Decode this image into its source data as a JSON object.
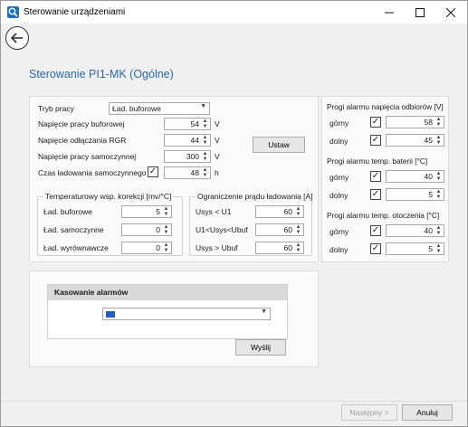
{
  "window": {
    "title": "Sterowanie urządzeniami"
  },
  "page": {
    "title": "Sterowanie PI1-MK (Ogólne)"
  },
  "main": {
    "tryb_label": "Tryb pracy",
    "tryb_value": "Ład. buforowe",
    "fields": [
      {
        "label": "Napięcie pracy buforowej",
        "value": "54",
        "unit": "V"
      },
      {
        "label": "Napięcie odłączania RGR",
        "value": "44",
        "unit": "V"
      },
      {
        "label": "Napięcie pracy samoczynnej",
        "value": "300",
        "unit": "V"
      },
      {
        "label": "Czas ładowania samoczynnego",
        "value": "48",
        "unit": "h"
      }
    ],
    "ustaw_label": "Ustaw",
    "temp_group": {
      "title": "Temperaturowy wsp. korekcji [mv/°C]",
      "rows": [
        {
          "label": "Ład. buforowe",
          "value": "5"
        },
        {
          "label": "Ład. samoczynne",
          "value": "0"
        },
        {
          "label": "Ład. wyrównawcze",
          "value": "0"
        }
      ]
    },
    "current_group": {
      "title": "Ograniczenie prądu ładowania [A]",
      "rows": [
        {
          "label": "Usys < U1",
          "value": "60"
        },
        {
          "label": "U1<Usys<Ubuf",
          "value": "60"
        },
        {
          "label": "Usys > Ubuf",
          "value": "60"
        }
      ]
    }
  },
  "alarms": [
    {
      "title": "Progi alarmu napięcia odbiorów [V]",
      "upper_label": "górny",
      "upper_value": "58",
      "lower_label": "dolny",
      "lower_value": "45"
    },
    {
      "title": "Progi alarmu temp. baterii [°C]",
      "upper_label": "górny",
      "upper_value": "40",
      "lower_label": "dolny",
      "lower_value": "5"
    },
    {
      "title": "Progi alarmu temp. otoczenia [°C]",
      "upper_label": "górny",
      "upper_value": "40",
      "lower_label": "dolny",
      "lower_value": "5"
    }
  ],
  "reset": {
    "title": "Kasowanie alarmów",
    "select_value": "",
    "send_label": "Wyślij"
  },
  "footer": {
    "next_label": "Następny >",
    "cancel_label": "Anuluj"
  }
}
